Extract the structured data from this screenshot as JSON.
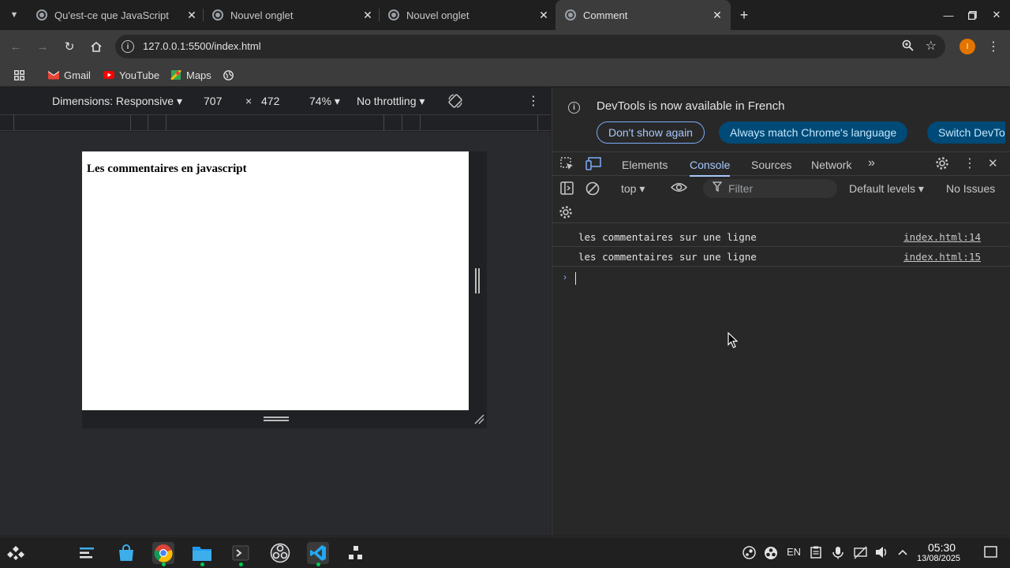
{
  "browser": {
    "tabs": [
      {
        "title": "Qu'est-ce que JavaScript",
        "active": false
      },
      {
        "title": "Nouvel onglet",
        "active": false
      },
      {
        "title": "Nouvel onglet",
        "active": false
      },
      {
        "title": "Comment",
        "active": true
      }
    ],
    "new_tab": "+",
    "address": "127.0.0.1:5500/index.html",
    "profile_initial": "I",
    "bookmarks": [
      "Gmail",
      "YouTube",
      "Maps"
    ]
  },
  "device_toolbar": {
    "dimensions_label": "Dimensions: Responsive",
    "width": "707",
    "times": "×",
    "height": "472",
    "zoom": "74%",
    "throttling": "No throttling"
  },
  "page": {
    "heading": "Les commentaires en javascript"
  },
  "devtools": {
    "infobar": {
      "message": "DevTools is now available in French",
      "dont_show": "Don't show again",
      "match_language": "Always match Chrome's language",
      "switch": "Switch DevTo"
    },
    "tabs": [
      "Elements",
      "Console",
      "Sources",
      "Network"
    ],
    "active_tab": "Console",
    "console_bar": {
      "context": "top",
      "filter_placeholder": "Filter",
      "levels": "Default levels",
      "issues": "No Issues"
    },
    "logs": [
      {
        "message": "les commentaires sur une ligne",
        "source": "index.html:14"
      },
      {
        "message": "les commentaires sur une ligne",
        "source": "index.html:15"
      }
    ]
  },
  "taskbar": {
    "lang": "EN",
    "time": "05:30",
    "date": "13/08/2025"
  },
  "colors": {
    "accent": "#a8c7fa",
    "pill_fill": "#004a77",
    "devtools_bg": "#282828",
    "chrome_bg": "#1f1f1f"
  }
}
